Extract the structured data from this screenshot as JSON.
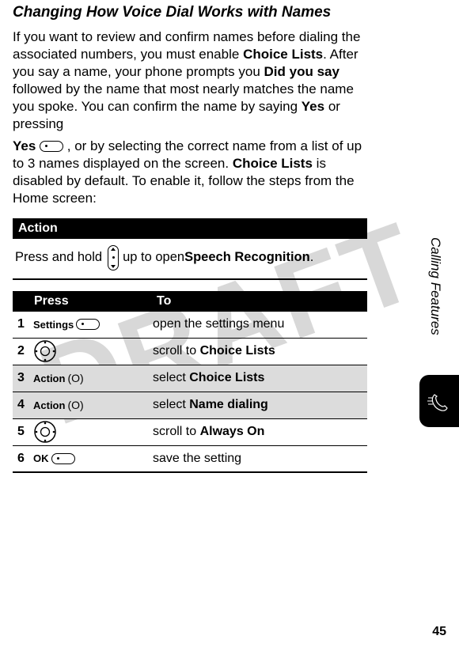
{
  "watermark": "DRAFT",
  "sectionTitle": "Changing How Voice Dial Works with Names",
  "para1_a": "If you want to review and confirm names before dialing the associated numbers, you must enable ",
  "para1_bold1": "Choice Lists",
  "para1_b": ". After you say a name, your phone prompts you ",
  "para1_bold2": "Did you say",
  "para1_c": " followed by the name that most nearly matches the name you spoke. You can confirm the name by saying ",
  "para1_bold3": "Yes",
  "para1_d": " or pressing",
  "para2_bold1": "Yes",
  "para2_a": " , or by selecting the correct name from a list of up to 3 names displayed on the screen. ",
  "para2_bold2": "Choice Lists",
  "para2_b": " is disabled by default. To enable it, follow the steps from the Home screen:",
  "actionHeader": "Action",
  "actionRow_a": "Press and hold",
  "actionRow_b": "up to open ",
  "actionRow_bold": "Speech Recognition",
  "actionRow_c": ".",
  "tableHeader": {
    "press": "Press",
    "to": "To"
  },
  "steps": [
    {
      "num": "1",
      "label": "Settings",
      "icon": "softkey",
      "to_a": "open the settings menu",
      "to_bold": ""
    },
    {
      "num": "2",
      "label": "",
      "icon": "nav",
      "to_a": "scroll to ",
      "to_bold": "Choice Lists"
    },
    {
      "num": "3",
      "label": "Action",
      "icon": "okey",
      "to_a": "select ",
      "to_bold": "Choice Lists"
    },
    {
      "num": "4",
      "label": "Action",
      "icon": "okey",
      "to_a": "select ",
      "to_bold": "Name dialing"
    },
    {
      "num": "5",
      "label": "",
      "icon": "nav",
      "to_a": "scroll to ",
      "to_bold": "Always On"
    },
    {
      "num": "6",
      "label": "OK",
      "icon": "softkey",
      "to_a": "save the setting",
      "to_bold": ""
    }
  ],
  "okeyText": "(O)",
  "sideText": "Calling Features",
  "pageNumber": "45"
}
